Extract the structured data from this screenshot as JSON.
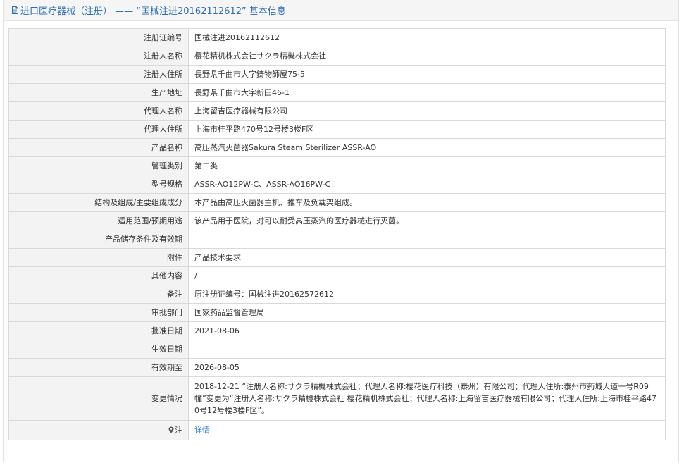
{
  "header": {
    "title": "进口医疗器械（注册） ——  “国械注进20162112612” 基本信息"
  },
  "rows": [
    {
      "label": "注册证编号",
      "value": "国械注进20162112612"
    },
    {
      "label": "注册人名称",
      "value": "樱花精机株式会社サクラ精機株式会社"
    },
    {
      "label": "注册人住所",
      "value": "長野県千曲市大字鋳物師屋75-5"
    },
    {
      "label": "生产地址",
      "value": "長野県千曲市大字新田46-1"
    },
    {
      "label": "代理人名称",
      "value": "上海留吉医疗器械有限公司"
    },
    {
      "label": "代理人住所",
      "value": "上海市桂平路470号12号楼3楼F区"
    },
    {
      "label": "产品名称",
      "value": "高压蒸汽灭菌器Sakura Steam Sterilizer ASSR-AO"
    },
    {
      "label": "管理类别",
      "value": "第二类"
    },
    {
      "label": "型号规格",
      "value": "ASSR-AO12PW-C、ASSR-AO16PW-C"
    },
    {
      "label": "结构及组成/主要组成成分",
      "value": "本产品由高压灭菌器主机、推车及负载架组成。"
    },
    {
      "label": "适用范围/预期用途",
      "value": "该产品用于医院，对可以耐受高压蒸汽的医疗器械进行灭菌。"
    },
    {
      "label": "产品储存条件及有效期",
      "value": ""
    },
    {
      "label": "附件",
      "value": "产品技术要求"
    },
    {
      "label": "其他内容",
      "value": "/"
    },
    {
      "label": "备注",
      "value": "原注册证编号：国械注进20162572612"
    },
    {
      "label": "审批部门",
      "value": "国家药品监督管理局"
    },
    {
      "label": "批准日期",
      "value": "2021-08-06"
    },
    {
      "label": "生效日期",
      "value": ""
    },
    {
      "label": "有效期至",
      "value": "2026-08-05"
    },
    {
      "label": "变更情况",
      "value": "2018-12-21 “注册人名称:サクラ精機株式会社；代理人名称:樱花医疗科技（泰州）有限公司；代理人住所:泰州市药城大道一号R09幢”变更为“注册人名称:サクラ精機株式会社 樱花精机株式会社；代理人名称:上海留吉医疗器械有限公司；代理人住所:上海市桂平路470号12号楼3楼F区”。"
    }
  ],
  "note": {
    "label": "注",
    "link_text": "详情",
    "icon": "pin-icon"
  }
}
